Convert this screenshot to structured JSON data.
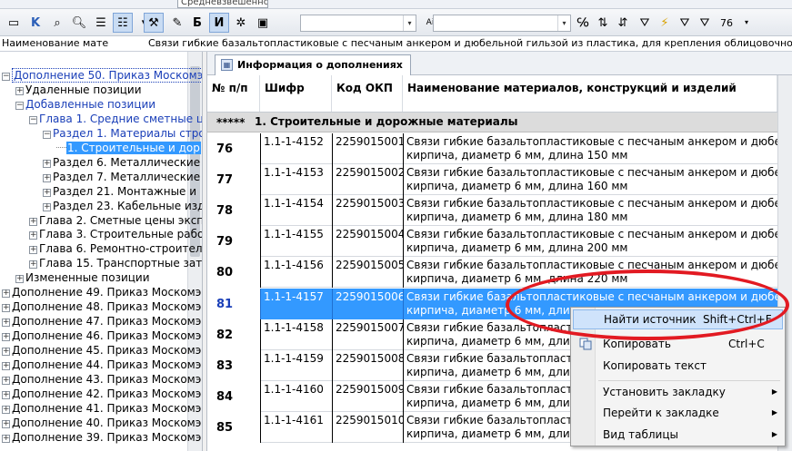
{
  "toolbar": {
    "weighting_combo": "Средневзвешенно",
    "zoom": "76"
  },
  "infobar": {
    "label": "Наименование материа",
    "value": "Связи гибкие базальтопластиковые с песчаным анкером и дюбельной гильзой из пластика, для крепления облицовочного слоя к несущей"
  },
  "tree": {
    "items": [
      {
        "label": "Дополнение 50. Приказ Москомэк",
        "exp": "−",
        "indent": 0,
        "blue": true
      },
      {
        "label": "Удаленные позиции",
        "exp": "+",
        "indent": 1,
        "blue": false
      },
      {
        "label": "Добавленные позиции",
        "exp": "−",
        "indent": 1,
        "blue": true
      },
      {
        "label": "Глава 1. Средние сметные ц",
        "exp": "−",
        "indent": 2,
        "blue": true
      },
      {
        "label": "Раздел 1. Материалы стро",
        "exp": "−",
        "indent": 3,
        "blue": true
      },
      {
        "label": "1. Строительные и дор",
        "exp": "",
        "indent": 4,
        "blue": false,
        "selected": true
      },
      {
        "label": "Раздел 6. Металлические",
        "exp": "+",
        "indent": 3,
        "blue": false
      },
      {
        "label": "Раздел 7. Металлические",
        "exp": "+",
        "indent": 3,
        "blue": false
      },
      {
        "label": "Раздел 21. Монтажные и",
        "exp": "+",
        "indent": 3,
        "blue": false
      },
      {
        "label": "Раздел 23. Кабельные изд",
        "exp": "+",
        "indent": 3,
        "blue": false
      },
      {
        "label": "Глава 2. Сметные цены эксп",
        "exp": "+",
        "indent": 2,
        "blue": false
      },
      {
        "label": "Глава 3. Строительные рабо",
        "exp": "+",
        "indent": 2,
        "blue": false
      },
      {
        "label": "Глава 6. Ремонтно-строител",
        "exp": "+",
        "indent": 2,
        "blue": false
      },
      {
        "label": "Глава 15. Транспортные затр",
        "exp": "+",
        "indent": 2,
        "blue": false
      },
      {
        "label": "Измененные позиции",
        "exp": "+",
        "indent": 1,
        "blue": false
      },
      {
        "label": "Дополнение 49. Приказ Москомэк",
        "exp": "+",
        "indent": 0,
        "blue": false
      },
      {
        "label": "Дополнение 48. Приказ Москомэк",
        "exp": "+",
        "indent": 0,
        "blue": false
      },
      {
        "label": "Дополнение 47. Приказ Москомэк",
        "exp": "+",
        "indent": 0,
        "blue": false
      },
      {
        "label": "Дополнение 46. Приказ Москомэк",
        "exp": "+",
        "indent": 0,
        "blue": false
      },
      {
        "label": "Дополнение 45. Приказ Москомэк",
        "exp": "+",
        "indent": 0,
        "blue": false
      },
      {
        "label": "Дополнение 44. Приказ Москомэк",
        "exp": "+",
        "indent": 0,
        "blue": false
      },
      {
        "label": "Дополнение 43. Приказ Москомэк",
        "exp": "+",
        "indent": 0,
        "blue": false
      },
      {
        "label": "Дополнение 42. Приказ Москомэк",
        "exp": "+",
        "indent": 0,
        "blue": false
      },
      {
        "label": "Дополнение 41. Приказ Москомэк",
        "exp": "+",
        "indent": 0,
        "blue": false
      },
      {
        "label": "Дополнение 40. Приказ Москомэк",
        "exp": "+",
        "indent": 0,
        "blue": false
      },
      {
        "label": "Дополнение 39. Приказ Москомэк",
        "exp": "+",
        "indent": 0,
        "blue": false
      }
    ]
  },
  "panel": {
    "tab_label": "Информация о дополнениях"
  },
  "grid": {
    "headers": [
      "№ п/п",
      "Шифр",
      "Код ОКП",
      "Наименование материалов, конструкций и изделий"
    ],
    "group_stars": "*****",
    "group_name": "1. Строительные и дорожные материалы",
    "rows": [
      {
        "num": "76",
        "code": "1.1-1-4152",
        "okp": "2259015001",
        "name1": "Связи гибкие базальтопластиковые с песчаным анкером и дюбельной гил",
        "name2": "кирпича, диаметр 6 мм, длина 150 мм"
      },
      {
        "num": "77",
        "code": "1.1-1-4153",
        "okp": "2259015002",
        "name1": "Связи гибкие базальтопластиковые с песчаным анкером и дюбельной гил",
        "name2": "кирпича, диаметр 6 мм, длина 160 мм"
      },
      {
        "num": "78",
        "code": "1.1-1-4154",
        "okp": "2259015003",
        "name1": "Связи гибкие базальтопластиковые с песчаным анкером и дюбельной гил",
        "name2": "кирпича, диаметр 6 мм, длина 180 мм"
      },
      {
        "num": "79",
        "code": "1.1-1-4155",
        "okp": "2259015004",
        "name1": "Связи гибкие базальтопластиковые с песчаным анкером и дюбельной гил",
        "name2": "кирпича, диаметр 6 мм, длина 200 мм"
      },
      {
        "num": "80",
        "code": "1.1-1-4156",
        "okp": "2259015005",
        "name1": "Связи гибкие базальтопластиковые с песчаным анкером и дюбельной гил",
        "name2": "кирпича, диаметр 6 мм, длина 220 мм"
      },
      {
        "num": "81",
        "code": "1.1-1-4157",
        "okp": "2259015006",
        "name1": "Связи гибкие базальтопластиковые с песчаным анкером и дюбельной гил",
        "name2": "кирпича, диаметр 6 мм, длина",
        "selected": true
      },
      {
        "num": "82",
        "code": "1.1-1-4158",
        "okp": "2259015007",
        "name1": "Связи гибкие базальтопластиковые с песчаным анкером и дюбельной гил",
        "name2": "кирпича, диаметр 6 мм, длина"
      },
      {
        "num": "83",
        "code": "1.1-1-4159",
        "okp": "2259015008",
        "name1": "Связи гибкие базальтопластиковые с песчаным анкером и дюбельной гил",
        "name2": "кирпича, диаметр 6 мм, длина"
      },
      {
        "num": "84",
        "code": "1.1-1-4160",
        "okp": "2259015009",
        "name1": "Связи гибкие базальтопластиковые с песчаным анкером и дюбельной гил",
        "name2": "кирпича, диаметр 6 мм, длина"
      },
      {
        "num": "85",
        "code": "1.1-1-4161",
        "okp": "2259015010",
        "name1": "Связи гибкие базальтопластиковые с песчаным анкером и дюбельной гил",
        "name2": "кирпича, диаметр 6 мм, длина"
      }
    ]
  },
  "context_menu": {
    "find_source": "Найти источник",
    "find_source_key": "Shift+Ctrl+F",
    "copy": "Копировать",
    "copy_key": "Ctrl+C",
    "copy_text": "Копировать текст",
    "set_bookmark": "Установить закладку",
    "goto_bookmark": "Перейти к закладке",
    "table_view": "Вид таблицы"
  },
  "colors": {
    "selection": "#3399ff",
    "highlight_oval": "#e21a22",
    "menu_hover": "#cfe3fb"
  }
}
